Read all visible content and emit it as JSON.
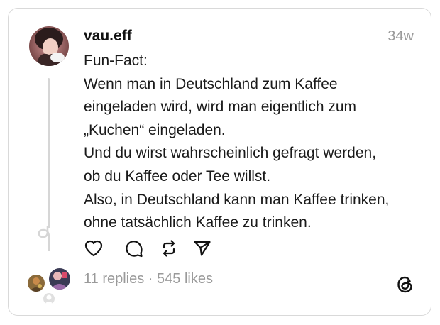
{
  "post": {
    "username": "vau.eff",
    "timestamp": "34w",
    "lines": [
      "Fun-Fact:",
      "Wenn man in Deutschland zum Kaffee",
      "eingeladen wird, wird man eigentlich zum",
      "„Kuchen“ eingeladen.",
      "Und du wirst wahrscheinlich gefragt werden,",
      "ob du Kaffee oder Tee willst.",
      "Also, in Deutschland kann man Kaffee trinken,",
      "ohne tatsächlich Kaffee zu trinken."
    ]
  },
  "actions": {
    "like_icon": "heart-icon",
    "reply_icon": "comment-bubble-icon",
    "repost_icon": "repost-icon",
    "share_icon": "send-icon"
  },
  "stats": {
    "replies": "11 replies",
    "separator": " · ",
    "likes": "545 likes"
  },
  "brand": {
    "logo_icon": "threads-logo-icon"
  },
  "colors": {
    "text": "#1a1a1a",
    "muted": "#9a9a9a",
    "border": "#d9d9d9"
  }
}
